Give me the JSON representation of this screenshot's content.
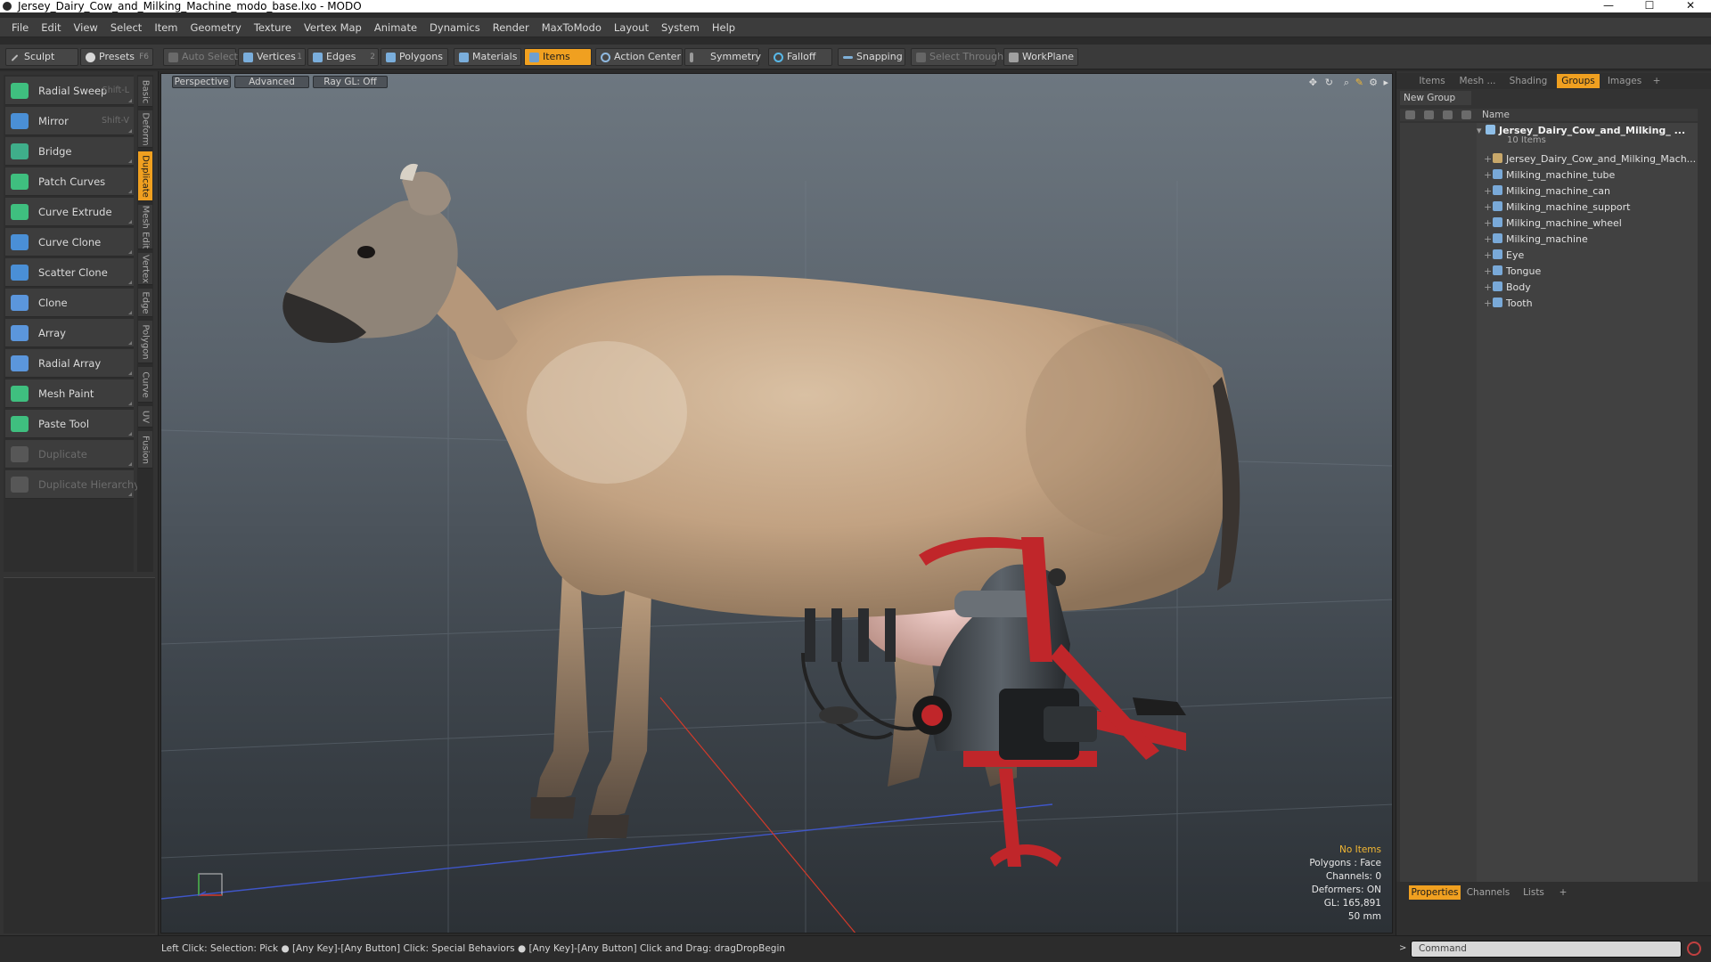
{
  "window": {
    "title": "Jersey_Dairy_Cow_and_Milking_Machine_modo_base.lxo - MODO",
    "controls": [
      "—",
      "☐",
      "✕"
    ]
  },
  "menu": [
    "File",
    "Edit",
    "View",
    "Select",
    "Item",
    "Geometry",
    "Texture",
    "Vertex Map",
    "Animate",
    "Dynamics",
    "Render",
    "MaxToModo",
    "Layout",
    "System",
    "Help"
  ],
  "toolbar": {
    "sculpt": "Sculpt",
    "presets": "Presets",
    "presets_key": "F6",
    "auto_select": "Auto Select",
    "vertices": "Vertices",
    "vertices_num": "1",
    "edges": "Edges",
    "edges_num": "2",
    "polygons": "Polygons",
    "materials": "Materials",
    "items": "Items",
    "action_center": "Action Center",
    "symmetry": "Symmetry",
    "falloff": "Falloff",
    "snapping": "Snapping",
    "select_through": "Select Through",
    "workplane": "WorkPlane"
  },
  "tools": [
    {
      "label": "Radial Sweep",
      "key": "Shift-L",
      "color": "#3fbf7f",
      "disabled": false
    },
    {
      "label": "Mirror",
      "key": "Shift-V",
      "color": "#4a8fd6",
      "disabled": false
    },
    {
      "label": "Bridge",
      "key": "",
      "color": "#3fae8a",
      "disabled": false
    },
    {
      "label": "Patch Curves",
      "key": "",
      "color": "#3fbf7f",
      "disabled": false
    },
    {
      "label": "Curve Extrude",
      "key": "",
      "color": "#3fbf7f",
      "disabled": false
    },
    {
      "label": "Curve Clone",
      "key": "",
      "color": "#4a8fd6",
      "disabled": false
    },
    {
      "label": "Scatter Clone",
      "key": "",
      "color": "#4a8fd6",
      "disabled": false
    },
    {
      "label": "Clone",
      "key": "",
      "color": "#5b96dc",
      "disabled": false
    },
    {
      "label": "Array",
      "key": "",
      "color": "#5b96dc",
      "disabled": false
    },
    {
      "label": "Radial Array",
      "key": "",
      "color": "#5b96dc",
      "disabled": false
    },
    {
      "label": "Mesh Paint",
      "key": "",
      "color": "#3fbf7f",
      "disabled": false
    },
    {
      "label": "Paste Tool",
      "key": "",
      "color": "#3fbf7f",
      "disabled": false
    },
    {
      "label": "Duplicate",
      "key": "",
      "color": "#8a8a8a",
      "disabled": true
    },
    {
      "label": "Duplicate Hierarchy",
      "key": "",
      "color": "#8a8a8a",
      "disabled": true
    }
  ],
  "vtabs": [
    {
      "label": "Basic",
      "active": false
    },
    {
      "label": "Deform",
      "active": false
    },
    {
      "label": "Duplicate",
      "active": true
    },
    {
      "label": "Mesh Edit",
      "active": false
    },
    {
      "label": "Vertex",
      "active": false
    },
    {
      "label": "Edge",
      "active": false
    },
    {
      "label": "Polygon",
      "active": false
    },
    {
      "label": "Curve",
      "active": false
    },
    {
      "label": "UV",
      "active": false
    },
    {
      "label": "Fusion",
      "active": false
    }
  ],
  "viewport": {
    "view": "Perspective",
    "shading": "Advanced",
    "raygl": "Ray GL: Off",
    "stats": {
      "selection": "No Items",
      "polygons": "Polygons : Face",
      "channels": "Channels: 0",
      "deformers": "Deformers: ON",
      "gl": "GL: 165,891",
      "scale": "50 mm"
    }
  },
  "right_panel": {
    "tabs": [
      {
        "label": "Items",
        "active": false
      },
      {
        "label": "Mesh ...",
        "active": false
      },
      {
        "label": "Shading",
        "active": false
      },
      {
        "label": "Groups",
        "active": true
      },
      {
        "label": "Images",
        "active": false
      },
      {
        "label": "+",
        "active": false
      }
    ],
    "new_group": "New Group",
    "column_name": "Name",
    "root": {
      "name": "Jersey_Dairy_Cow_and_Milking_ ...",
      "count": "10 Items"
    },
    "items": [
      {
        "name": "Jersey_Dairy_Cow_and_Milking_Mach...",
        "type": "locator"
      },
      {
        "name": "Milking_machine_tube",
        "type": "mesh"
      },
      {
        "name": "Milking_machine_can",
        "type": "mesh"
      },
      {
        "name": "Milking_machine_support",
        "type": "mesh"
      },
      {
        "name": "Milking_machine_wheel",
        "type": "mesh"
      },
      {
        "name": "Milking_machine",
        "type": "mesh"
      },
      {
        "name": "Eye",
        "type": "mesh"
      },
      {
        "name": "Tongue",
        "type": "mesh"
      },
      {
        "name": "Body",
        "type": "mesh"
      },
      {
        "name": "Tooth",
        "type": "mesh"
      }
    ],
    "bottom_tabs": [
      {
        "label": "Properties",
        "active": true
      },
      {
        "label": "Channels",
        "active": false
      },
      {
        "label": "Lists",
        "active": false
      },
      {
        "label": "+",
        "active": false
      }
    ]
  },
  "status": {
    "text": "Left Click: Selection: Pick ● [Any Key]-[Any Button] Click: Special Behaviors ● [Any Key]-[Any Button] Click and Drag: dragDropBegin",
    "command_placeholder": "Command"
  },
  "colors": {
    "accent": "#f0a020",
    "panel": "#333333",
    "cow_body": "#c9ab8c",
    "machine_red": "#c0262a"
  }
}
